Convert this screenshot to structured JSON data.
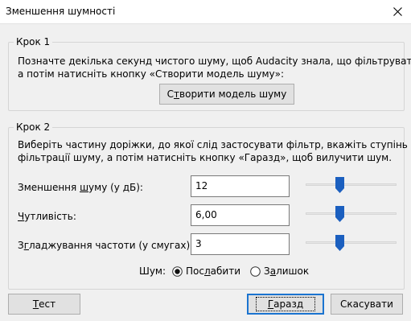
{
  "window": {
    "title": "Зменшення шумності"
  },
  "step1": {
    "legend": "Крок 1",
    "line1": "Позначте декілька секунд чистого шуму, щоб Audacity знала, що фільтрувати,",
    "line2": "а потім натисніть кнопку «Створити модель шуму»:",
    "button_pre": "С",
    "button_mnemonic": "т",
    "button_post": "ворити модель шуму"
  },
  "step2": {
    "legend": "Крок 2",
    "line1": "Виберіть частину доріжки, до якої слід застосувати фільтр, вкажіть ступінь",
    "line2": "фільтрації шуму, а потім натисніть кнопку «Гаразд», щоб вилучити шум."
  },
  "params": [
    {
      "label_pre": "Зменшення ",
      "mnemonic": "ш",
      "label_post": "уму (у дБ):",
      "value": "12",
      "slider_level": 0.36
    },
    {
      "label_pre": "",
      "mnemonic": "Ч",
      "label_post": "утливість:",
      "value": "6,00",
      "slider_level": 0.36
    },
    {
      "label_pre": "З",
      "mnemonic": "г",
      "label_post": "ладжування частоти (у смугах):",
      "value": "3",
      "slider_level": 0.36
    }
  ],
  "noise": {
    "label": "Шум:",
    "options": [
      {
        "pre": "Пос",
        "mnemonic": "л",
        "post": "абити",
        "selected": true
      },
      {
        "pre": "З",
        "mnemonic": "а",
        "post": "лишок",
        "selected": false
      }
    ]
  },
  "buttons": {
    "test_mnemonic": "Т",
    "test_post": "ест",
    "ok_mnemonic": "Г",
    "ok_post": "аразд",
    "cancel": "Скасувати"
  },
  "colors": {
    "accent": "#1b74d0",
    "slider_thumb": "#1b5fbf"
  }
}
